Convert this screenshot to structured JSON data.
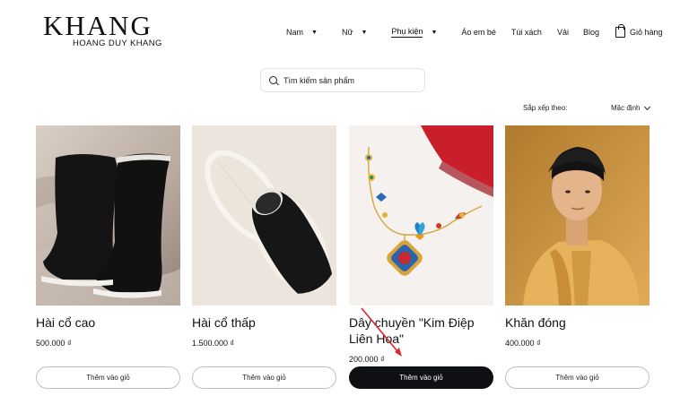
{
  "brand": {
    "name": "KHANG",
    "tagline": "HOANG DUY KHANG"
  },
  "nav": [
    {
      "label": "Nam",
      "dropdown": true
    },
    {
      "label": "Nữ",
      "dropdown": true
    },
    {
      "label": "Phụ kiện",
      "dropdown": true,
      "active": true
    },
    {
      "label": "Áo em bé",
      "dropdown": false
    },
    {
      "label": "Túi xách",
      "dropdown": false
    },
    {
      "label": "Vải",
      "dropdown": false
    },
    {
      "label": "Blog",
      "dropdown": false
    },
    {
      "label": "Giỏ hàng",
      "dropdown": false,
      "icon": "shopping-bag-icon"
    }
  ],
  "search": {
    "placeholder": "Tìm kiếm sản phẩm",
    "value": ""
  },
  "sort": {
    "label": "Sắp xếp theo:",
    "selected": "Mặc định"
  },
  "products": [
    {
      "name": "Hài cổ cao",
      "price": "500.000 ₫",
      "button": "Thêm vào giỏ",
      "image": "tall-black-boots"
    },
    {
      "name": "Hài cổ thấp",
      "price": "1.500.000 ₫",
      "button": "Thêm vào giỏ",
      "image": "low-black-shoes"
    },
    {
      "name": "Dây chuyền \"Kim Điệp Liên Hoa\"",
      "price": "200.000 ₫",
      "button": "Thêm vào giỏ",
      "image": "butterfly-necklace",
      "button_hovered": true
    },
    {
      "name": "Khăn đóng",
      "price": "400.000 ₫",
      "button": "Thêm vào giỏ",
      "image": "man-in-khan-dong"
    }
  ],
  "colors": {
    "accent_button": "#0e1013",
    "annotation_arrow": "#e0242b"
  }
}
